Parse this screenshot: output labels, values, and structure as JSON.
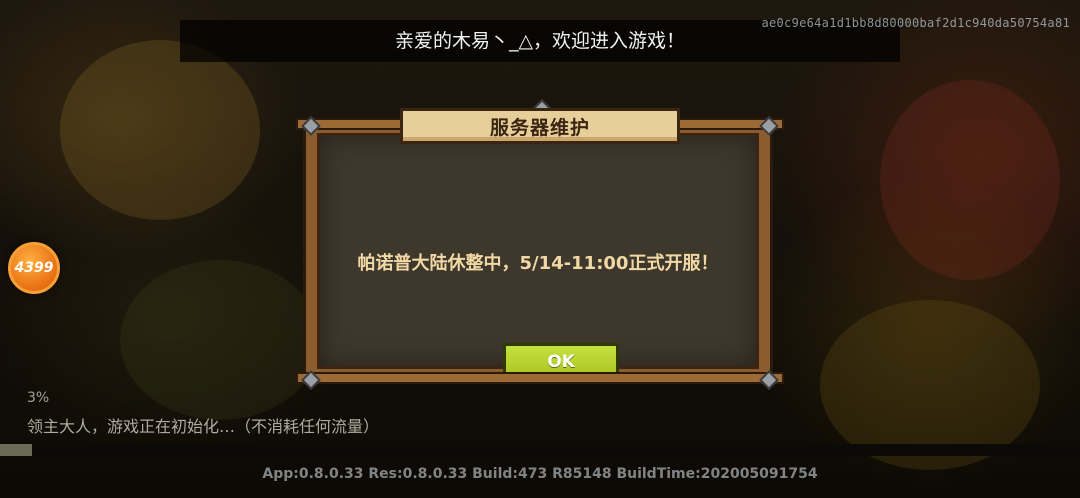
{
  "toast": {
    "text": "亲爱的木易丶_△，欢迎进入游戏！"
  },
  "device_id": "ae0c9e64a1d1bb8d80000baf2d1c940da50754a81",
  "brand": {
    "logo_text": "4399",
    "accent": "#ee7a16"
  },
  "dialog": {
    "title": "服务器维护",
    "message": "帕诺普大陆休整中，5/14-11:00正式开服！",
    "ok_label": "OK"
  },
  "loading": {
    "percent_text": "3%",
    "progress": 0.03,
    "status": "领主大人，游戏正在初始化…（不消耗任何流量）"
  },
  "version_text": "App:0.8.0.33 Res:0.8.0.33 Build:473 R85148 BuildTime:202005091754",
  "colors": {
    "button_green": "#b6d02a",
    "frame_wood": "#8c5c2e",
    "title_plank": "#e8cf9a",
    "message_text": "#f1d9a6"
  }
}
